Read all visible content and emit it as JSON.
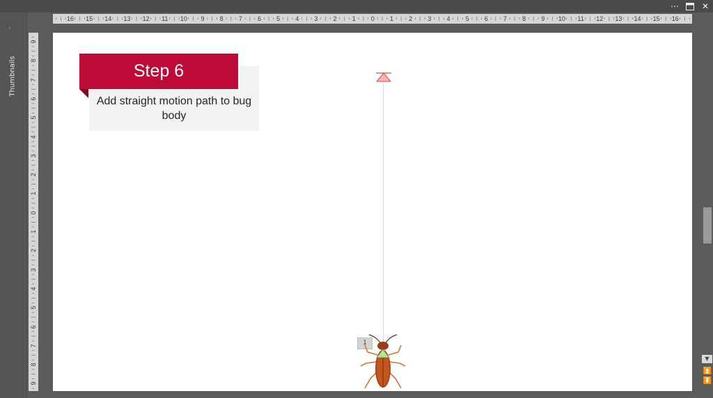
{
  "titlebar": {
    "more_icon": "more-icon",
    "restore_icon": "restore-icon",
    "close_icon": "close-icon"
  },
  "thumbnails_panel": {
    "label": "Thumbnails",
    "expand_icon": "chevron-right-icon"
  },
  "rulers": {
    "horizontal_labels": [
      "16",
      "15",
      "14",
      "13",
      "12",
      "11",
      "10",
      "9",
      "8",
      "7",
      "6",
      "5",
      "4",
      "3",
      "2",
      "1",
      "0",
      "1",
      "2",
      "3",
      "4",
      "5",
      "6",
      "7",
      "8",
      "9",
      "10",
      "11",
      "12",
      "13",
      "14",
      "15",
      "16"
    ],
    "vertical_labels": [
      "9",
      "8",
      "7",
      "6",
      "5",
      "4",
      "3",
      "2",
      "1",
      "0",
      "1",
      "2",
      "3",
      "4",
      "5",
      "6",
      "7",
      "8",
      "9"
    ]
  },
  "slide": {
    "step_title": "Step 6",
    "step_description": "Add straight motion path to bug body",
    "animation_order_tag": "1",
    "accent_color": "#bd0a36",
    "motion_path_end_icon": "motion-path-end-marker-icon",
    "bug_icon": "cockroach-icon"
  },
  "scrollbar": {
    "down_icon": "scroll-down-icon",
    "prev_slide_icon": "previous-slide-icon",
    "next_slide_icon": "next-slide-icon"
  }
}
